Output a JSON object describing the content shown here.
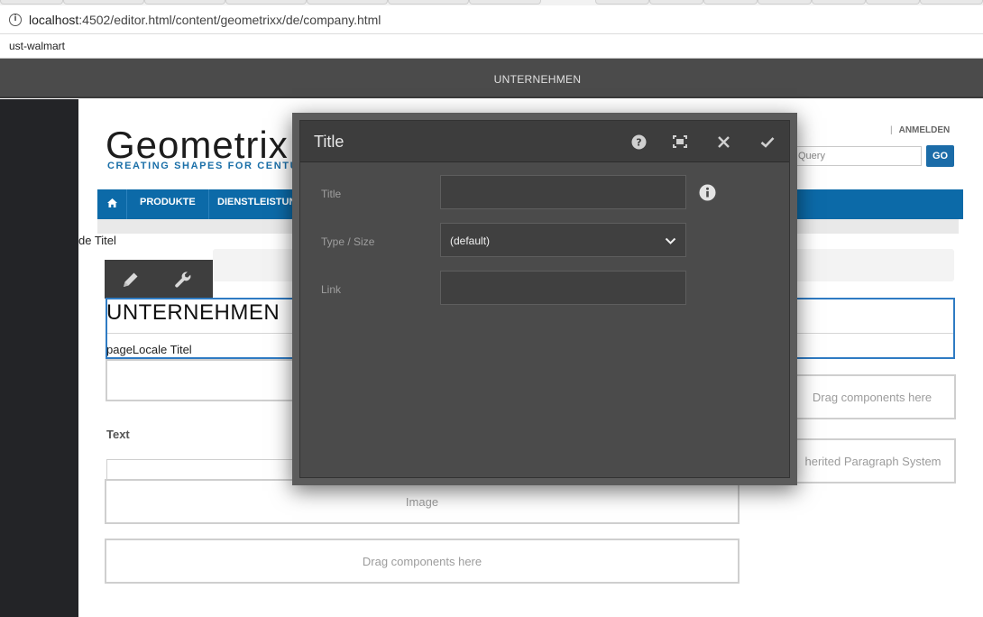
{
  "browser": {
    "url_host": "localhost",
    "url_path": ":4502/editor.html/content/geometrixx/de/company.html",
    "bookmark": "ust-walmart"
  },
  "editor": {
    "page_title": "UNTERNEHMEN"
  },
  "site": {
    "logo": "Geometrix",
    "tagline": "CREATING SHAPES FOR CENTUR",
    "login": "ANMELDEN",
    "search_placeholder": "Query",
    "go_label": "GO",
    "nav_home_icon": "home-icon",
    "nav": [
      "PRODUKTE",
      "DIENSTLEISTUNG"
    ]
  },
  "content": {
    "breadcrumb_title": "de Titel",
    "heading": "UNTERNEHMEN",
    "subtitle": "pageLocale Titel",
    "text_label": "Text",
    "image_placeholder": "Image",
    "drag_placeholder": "Drag components here",
    "right_drag_placeholder": "Drag components here",
    "iparsys_placeholder": "herited Paragraph System"
  },
  "toolbar": {
    "edit_icon": "pencil-icon",
    "config_icon": "wrench-icon"
  },
  "dialog": {
    "title": "Title",
    "help_icon": "help-icon",
    "fullscreen_icon": "fullscreen-icon",
    "close_icon": "close-icon",
    "done_icon": "checkmark-icon",
    "fields": {
      "title_label": "Title",
      "title_value": "",
      "type_label": "Type / Size",
      "type_value": "(default)",
      "link_label": "Link",
      "link_value": ""
    }
  }
}
